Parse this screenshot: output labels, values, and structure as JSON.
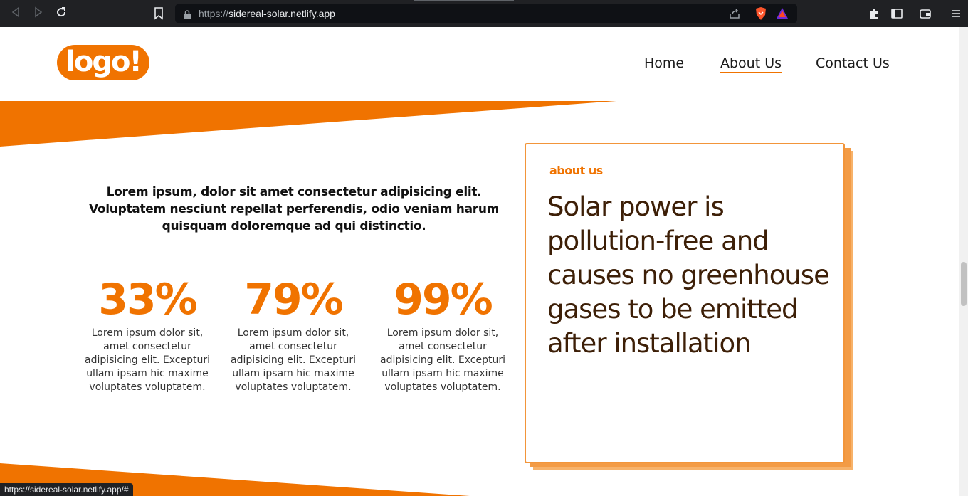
{
  "browser": {
    "url_protocol": "https://",
    "url_host": "sidereal-solar.netlify.app",
    "status_url": "https://sidereal-solar.netlify.app/#"
  },
  "site": {
    "logo_text": "logo!",
    "nav": [
      {
        "label": "Home",
        "active": false
      },
      {
        "label": "About Us",
        "active": true
      },
      {
        "label": "Contact Us",
        "active": false
      }
    ]
  },
  "intro": {
    "text": "Lorem ipsum, dolor sit amet consectetur adipisicing elit. Voluptatem nesciunt repellat perferendis, odio veniam harum quisquam doloremque ad qui distinctio."
  },
  "stats": [
    {
      "value": "33%",
      "description": "Lorem ipsum dolor sit, amet consectetur adipisicing elit. Excepturi ullam ipsam hic maxime voluptates voluptatem."
    },
    {
      "value": "79%",
      "description": "Lorem ipsum dolor sit, amet consectetur adipisicing elit. Excepturi ullam ipsam hic maxime voluptates voluptatem."
    },
    {
      "value": "99%",
      "description": "Lorem ipsum dolor sit, amet consectetur adipisicing elit. Excepturi ullam ipsam hic maxime voluptates voluptatem."
    }
  ],
  "about_card": {
    "eyebrow": "about us",
    "headline": "Solar power is pollution-free and causes no greenhouse gases to be emitted after installation"
  },
  "colors": {
    "accent": "#f07300",
    "headline": "#3d1f07",
    "chrome": "#202124"
  }
}
